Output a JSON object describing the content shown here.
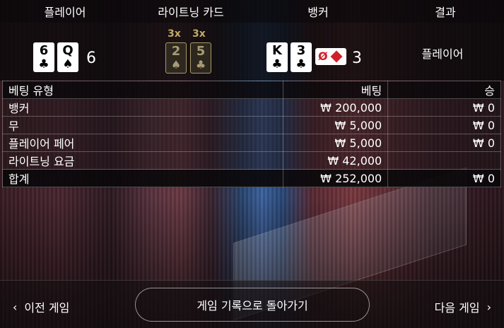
{
  "header": {
    "player": "플레이어",
    "lightning_cards": "라이트닝 카드",
    "banker": "뱅커",
    "result": "결과"
  },
  "player_hand": {
    "cards": [
      {
        "rank": "6",
        "suit": "♣",
        "color": "#000000"
      },
      {
        "rank": "Q",
        "suit": "♠",
        "color": "#000000"
      }
    ],
    "score": "6"
  },
  "lightning_cards": [
    {
      "multiplier": "3x",
      "rank": "2",
      "suit": "♠"
    },
    {
      "multiplier": "3x",
      "rank": "5",
      "suit": "♣"
    }
  ],
  "banker_hand": {
    "cards": [
      {
        "rank": "K",
        "suit": "♣",
        "color": "#000000"
      },
      {
        "rank": "3",
        "suit": "♣",
        "color": "#000000"
      }
    ],
    "badge": "Ø",
    "badge_icon": "diamond-icon",
    "score": "3"
  },
  "result_value": "플레이어",
  "table": {
    "columns": [
      "베팅 유형",
      "베팅",
      "승"
    ],
    "rows": [
      {
        "type": "뱅커",
        "bet": "₩ 200,000",
        "win": "₩ 0"
      },
      {
        "type": "무",
        "bet": "₩ 5,000",
        "win": "₩ 0"
      },
      {
        "type": "플레이어 페어",
        "bet": "₩ 5,000",
        "win": "₩ 0"
      },
      {
        "type": "라이트닝 요금",
        "bet": "₩ 42,000",
        "win": ""
      }
    ],
    "total": {
      "type": "합계",
      "bet": "₩ 252,000",
      "win": "₩ 0"
    }
  },
  "footer": {
    "prev_label": "이전 게임",
    "back_label": "게임 기록으로 돌아가기",
    "next_label": "다음 게임",
    "prev_icon": "chevron-left-icon",
    "next_icon": "chevron-right-icon"
  },
  "colors": {
    "accent_gold": "#c2a868",
    "red_suit": "#d0202a"
  }
}
